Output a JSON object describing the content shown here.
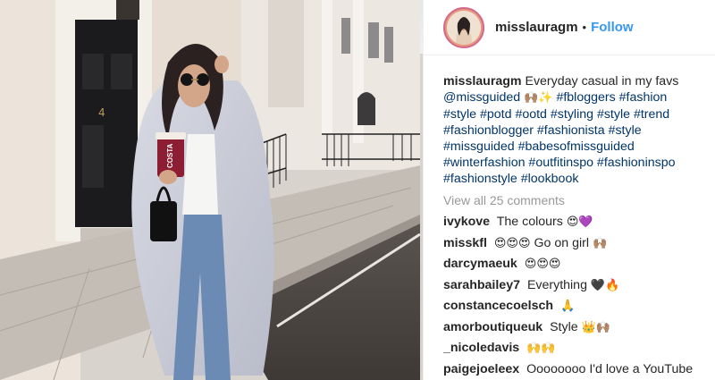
{
  "post": {
    "username": "misslauragm",
    "follow_label": "Follow",
    "separator": "•",
    "caption_text": "Everyday casual in my favs",
    "caption_emoji": "🙌🏽✨",
    "mention": "@missguided",
    "hashtags_line1": "#fbloggers #fashion",
    "hashtags_line2": "#style #potd #ootd #styling #style #trend",
    "hashtags_line3": "#fashionblogger #fashionista #style",
    "hashtags_line4": "#missguided #babesofmissguided",
    "hashtags_line5": "#winterfashion #outfitinspo #fashioninspo",
    "hashtags_line6": "#fashionstyle #lookbook",
    "view_all": "View all 25 comments"
  },
  "comments": [
    {
      "user": "ivykove",
      "text": "The colours",
      "emoji": "😍💜"
    },
    {
      "user": "misskfl",
      "text": "Go on girl",
      "emoji_before": "😍😍😍",
      "emoji": "🙌🏽"
    },
    {
      "user": "darcymaeuk",
      "text": "",
      "emoji": "😍😍😍"
    },
    {
      "user": "sarahbailey7",
      "text": "Everything",
      "emoji": "🖤🔥"
    },
    {
      "user": "constancecoelsch",
      "text": "",
      "emoji": "🙏"
    },
    {
      "user": "amorboutiqueuk",
      "text": "Style",
      "emoji": "👑🙌🏽"
    },
    {
      "user": "_nicoledavis",
      "text": "",
      "emoji": "🙌🙌"
    },
    {
      "user": "paigejoeleex",
      "text": "Oooooooo I'd love a YouTube",
      "emoji": ""
    }
  ],
  "photo": {
    "cup_label": "COSTA",
    "door_number": "4"
  }
}
